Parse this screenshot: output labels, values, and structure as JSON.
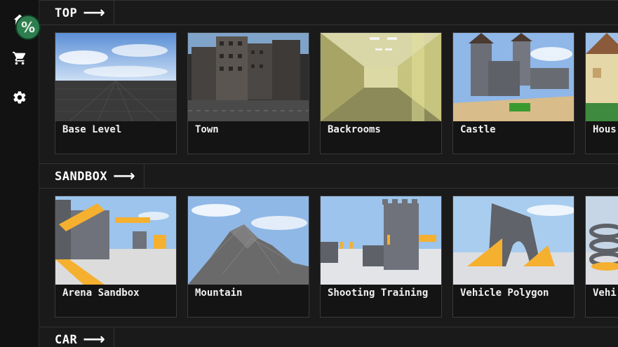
{
  "sidebar": {
    "items": [
      {
        "name": "home",
        "icon": "home-icon"
      },
      {
        "name": "shop",
        "icon": "cart-icon"
      },
      {
        "name": "settings",
        "icon": "gear-icon"
      }
    ],
    "avatar_icon": "percent-badge-icon"
  },
  "sections": [
    {
      "title": "TOP",
      "maps": [
        {
          "label": "Base Level",
          "thumb": "flat-grid"
        },
        {
          "label": "Town",
          "thumb": "city"
        },
        {
          "label": "Backrooms",
          "thumb": "yellow-hall"
        },
        {
          "label": "Castle",
          "thumb": "castle"
        },
        {
          "label": "Hous",
          "thumb": "house"
        }
      ]
    },
    {
      "title": "SANDBOX",
      "maps": [
        {
          "label": "Arena Sandbox",
          "thumb": "arena"
        },
        {
          "label": "Mountain",
          "thumb": "mountain"
        },
        {
          "label": "Shooting Training",
          "thumb": "shooting"
        },
        {
          "label": "Vehicle Polygon",
          "thumb": "polygon"
        },
        {
          "label": "Vehi",
          "thumb": "spiral"
        }
      ]
    },
    {
      "title": "CAR",
      "maps": []
    }
  ],
  "colors": {
    "background": "#1a1a1a",
    "sidebar": "#121212",
    "accent_green": "#2e7d4f",
    "orange": "#f5a623"
  }
}
